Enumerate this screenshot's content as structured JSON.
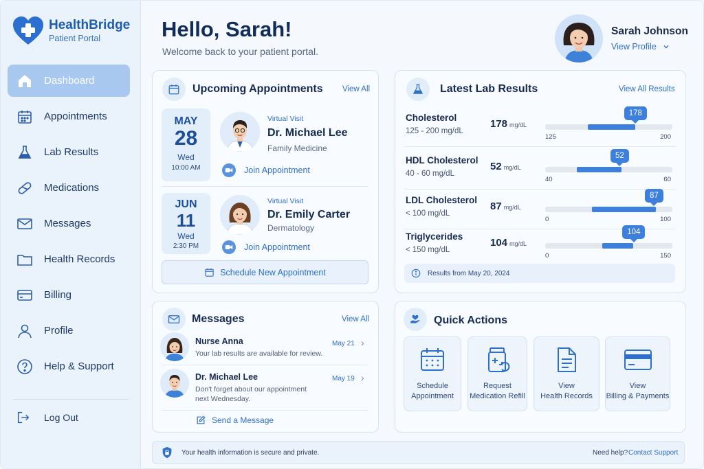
{
  "brand": {
    "name": "HealthBridge",
    "subtitle": "Patient Portal"
  },
  "nav": {
    "items": [
      {
        "label": "Dashboard",
        "icon": "home-icon",
        "active": true
      },
      {
        "label": "Appointments",
        "icon": "calendar-icon"
      },
      {
        "label": "Lab Results",
        "icon": "flask-icon"
      },
      {
        "label": "Medications",
        "icon": "pill-icon"
      },
      {
        "label": "Messages",
        "icon": "envelope-icon"
      },
      {
        "label": "Health Records",
        "icon": "folder-icon"
      },
      {
        "label": "Billing",
        "icon": "credit-card-icon"
      },
      {
        "label": "Profile",
        "icon": "user-icon"
      },
      {
        "label": "Help & Support",
        "icon": "question-icon"
      }
    ],
    "logout": "Log Out"
  },
  "header": {
    "greeting": "Hello, Sarah!",
    "subtitle": "Welcome back to your patient portal."
  },
  "profile": {
    "name": "Sarah Johnson",
    "link": "View Profile"
  },
  "appointments": {
    "title": "Upcoming Appointments",
    "view_all": "View All",
    "items": [
      {
        "month": "MAY",
        "day": "28",
        "weekday": "Wed",
        "time": "10:00 AM",
        "visit_type": "Virtual Visit",
        "doctor": "Dr. Michael Lee",
        "specialty": "Family Medicine",
        "action": "Join Appointment"
      },
      {
        "month": "JUN",
        "day": "11",
        "weekday": "Wed",
        "time": "2:30 PM",
        "visit_type": "Virtual Visit",
        "doctor": "Dr. Emily Carter",
        "specialty": "Dermatology",
        "action": "Join Appointment"
      }
    ],
    "schedule_button": "Schedule New Appointment"
  },
  "labs": {
    "title": "Latest Lab Results",
    "view_all": "View All Results",
    "unit": "mg/dL",
    "items": [
      {
        "name": "Cholesterol",
        "range": "125 - 200 mg/dL",
        "value": 178,
        "min": 125,
        "max": 200,
        "min_label": "125",
        "max_label": "200",
        "fill_from": 150
      },
      {
        "name": "HDL Cholesterol",
        "range": "40 - 60 mg/dL",
        "value": 52,
        "min": 40,
        "max": 60,
        "min_label": "40",
        "max_label": "60",
        "fill_from": 45
      },
      {
        "name": "LDL Cholesterol",
        "range": "< 100 mg/dL",
        "value": 87,
        "min": 0,
        "max": 100,
        "min_label": "0",
        "max_label": "100",
        "fill_from": 37
      },
      {
        "name": "Triglycerides",
        "range": "< 150 mg/dL",
        "value": 104,
        "min": 0,
        "max": 150,
        "min_label": "0",
        "max_label": "150",
        "fill_from": 67
      }
    ],
    "results_date": "Results from May 20, 2024"
  },
  "messages": {
    "title": "Messages",
    "view_all": "View All",
    "items": [
      {
        "from": "Nurse Anna",
        "text": "Your lab results are available for review.",
        "date": "May 21"
      },
      {
        "from": "Dr. Michael Lee",
        "text": "Don't forget about our appointment next Wednesday.",
        "date": "May 19"
      }
    ],
    "send": "Send a Message"
  },
  "quick_actions": {
    "title": "Quick Actions",
    "items": [
      {
        "line1": "Schedule",
        "line2": "Appointment",
        "icon": "calendar-icon"
      },
      {
        "line1": "Request",
        "line2": "Medication Refill",
        "icon": "pill-bottle-icon"
      },
      {
        "line1": "View",
        "line2": "Health Records",
        "icon": "document-icon"
      },
      {
        "line1": "View",
        "line2": "Billing & Payments",
        "icon": "credit-card-icon"
      }
    ]
  },
  "footer": {
    "security": "Your health information is secure and private.",
    "help": "Need help?",
    "contact": "Contact Support"
  },
  "colors": {
    "accent": "#2e6fcc",
    "sidebar_active": "#a9c8ef",
    "bar": "#3d7fdc"
  }
}
